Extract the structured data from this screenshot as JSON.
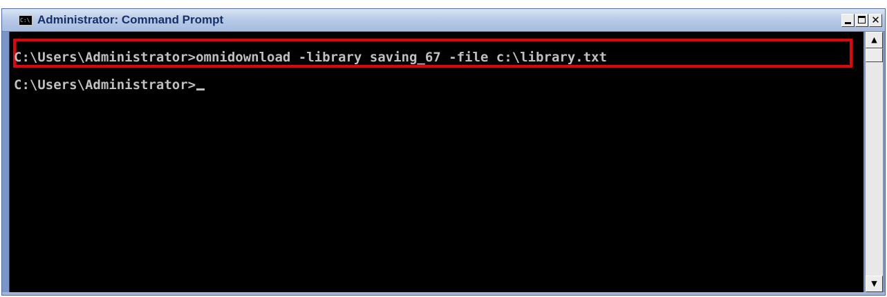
{
  "window": {
    "title": "Administrator: Command Prompt",
    "icon": "cmd-icon",
    "icon_label": "C:\\",
    "controls": {
      "minimize": "minimize-icon",
      "maximize": "maximize-icon",
      "close_label": "✕"
    }
  },
  "console": {
    "lines": [
      "C:\\Users\\Administrator>omnidownload -library saving_67 -file c:\\library.txt",
      "C:\\Users\\Administrator>"
    ],
    "highlighted_line": 0,
    "highlight_color": "#e8000b",
    "background": "#000000",
    "foreground": "#c0c0c0"
  },
  "scrollbar": {
    "up_label": "▲",
    "down_label": "▼"
  }
}
